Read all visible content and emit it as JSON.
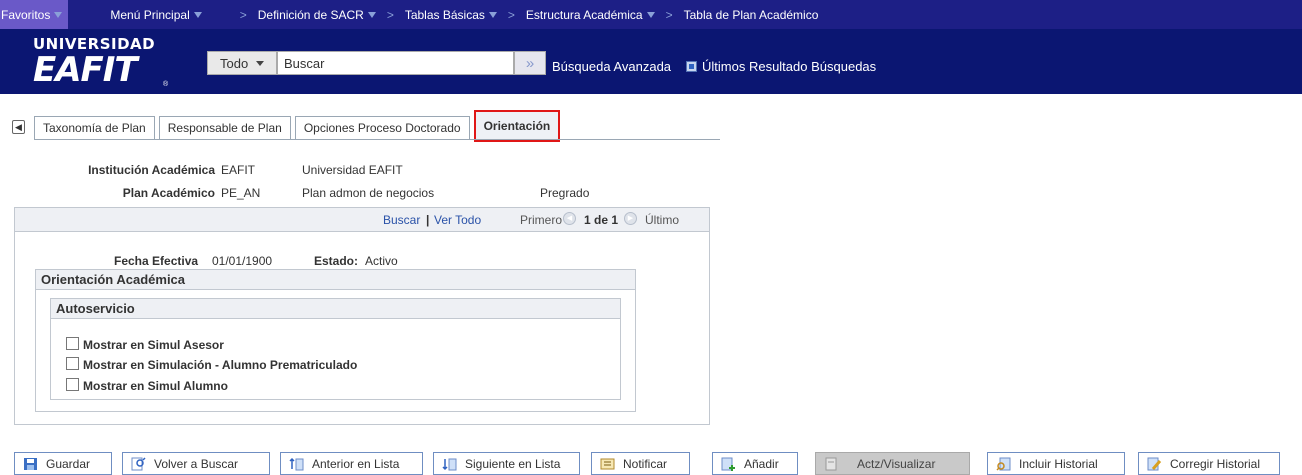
{
  "nav": {
    "items": [
      {
        "label": "Favoritos"
      },
      {
        "label": "Menú Principal"
      },
      {
        "label": "Definición de SACR"
      },
      {
        "label": "Tablas Básicas"
      },
      {
        "label": "Estructura Académica"
      },
      {
        "label": "Tabla de Plan Académico"
      }
    ],
    "separator": ">"
  },
  "header": {
    "logo_top": "UNIVERSIDAD",
    "logo_main": "EAFIT",
    "logo_reg": "®",
    "search_scope": "Todo",
    "search_value": "Buscar",
    "search_go": "»",
    "advanced_search": "Búsqueda Avanzada",
    "last_results": "Últimos Resultado Búsquedas"
  },
  "tabs": {
    "scroll_icon": "◀",
    "items": [
      {
        "label": "Taxonomía de Plan"
      },
      {
        "label": "Responsable de Plan"
      },
      {
        "label": "Opciones Proceso Doctorado"
      },
      {
        "label": "Orientación"
      }
    ]
  },
  "info": {
    "institution_label": "Institución Académica",
    "institution_code": "EAFIT",
    "institution_name": "Universidad EAFIT",
    "plan_label": "Plan Académico",
    "plan_code": "PE_AN",
    "plan_name": "Plan admon de negocios",
    "plan_career": "Pregrado"
  },
  "grid_nav": {
    "search": "Buscar",
    "divider": "|",
    "view_all": "Ver Todo",
    "first": "Primero",
    "count": "1 de 1",
    "last": "Último"
  },
  "record": {
    "effdt_label": "Fecha Efectiva",
    "effdt_value": "01/01/1900",
    "status_label": "Estado:",
    "status_value": "Activo"
  },
  "orientation": {
    "title": "Orientación Académica",
    "self_service_title": "Autoservicio",
    "options": [
      {
        "label": "Mostrar en Simul Asesor",
        "checked": false
      },
      {
        "label": "Mostrar en Simulación - Alumno Prematriculado",
        "checked": false
      },
      {
        "label": "Mostrar en Simul Alumno",
        "checked": false
      }
    ]
  },
  "toolbar": {
    "save": "Guardar",
    "return_search": "Volver a Buscar",
    "prev_list": "Anterior en Lista",
    "next_list": "Siguiente en Lista",
    "notify": "Notificar",
    "add": "Añadir",
    "update_display": "Actz/Visualizar",
    "include_history": "Incluir Historial",
    "correct_history": "Corregir Historial"
  },
  "colors": {
    "nav_bg": "#1d1f86",
    "header_bg": "#0b1672",
    "active_tab_border": "#e01717",
    "link": "#2a52a8"
  }
}
